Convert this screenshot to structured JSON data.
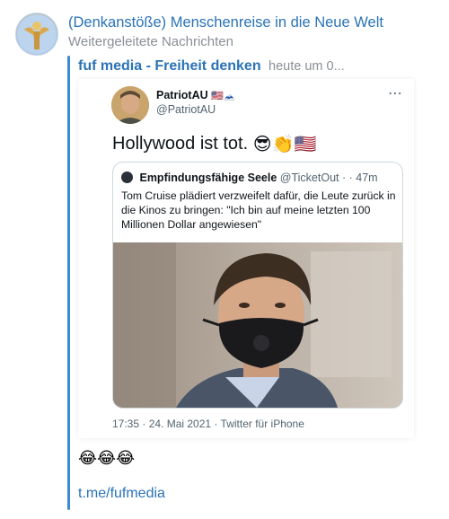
{
  "message": {
    "channel_title": "(Denkanstöße) Menschenreise in die Neue Welt",
    "forwarded_label": "Weitergeleitete Nachrichten",
    "source_name": "fuf media - Freiheit denken",
    "source_time": "heute um 0...",
    "reaction_emojis": "😂😂😂",
    "link_text": "t.me/fufmedia"
  },
  "tweet": {
    "display_name": "PatriotAU",
    "name_emojis": "🇺🇸🗻",
    "handle": "@PatriotAU",
    "more_icon": "⋯",
    "text": "Hollywood ist tot.",
    "text_emojis": "😎👏🇺🇸",
    "footer": "17:35 · 24. Mai 2021  ·  Twitter für iPhone",
    "quoted": {
      "name": "Empfindungsfähige Seele",
      "handle_time": "@TicketOut · · 47m",
      "text": "Tom Cruise plädiert verzweifelt dafür, die Leute zurück in die Kinos zu bringen: \"Ich bin auf meine letzten 100 Millionen Dollar angewiesen\""
    }
  },
  "colors": {
    "accent_blue": "#2a73b6",
    "quote_bar": "#3a8ad6",
    "muted_gray": "#8a8f96"
  },
  "icons": [
    "channel-avatar-icon",
    "tweet-avatar-icon",
    "more-options-icon",
    "quoted-avatar-icon"
  ]
}
